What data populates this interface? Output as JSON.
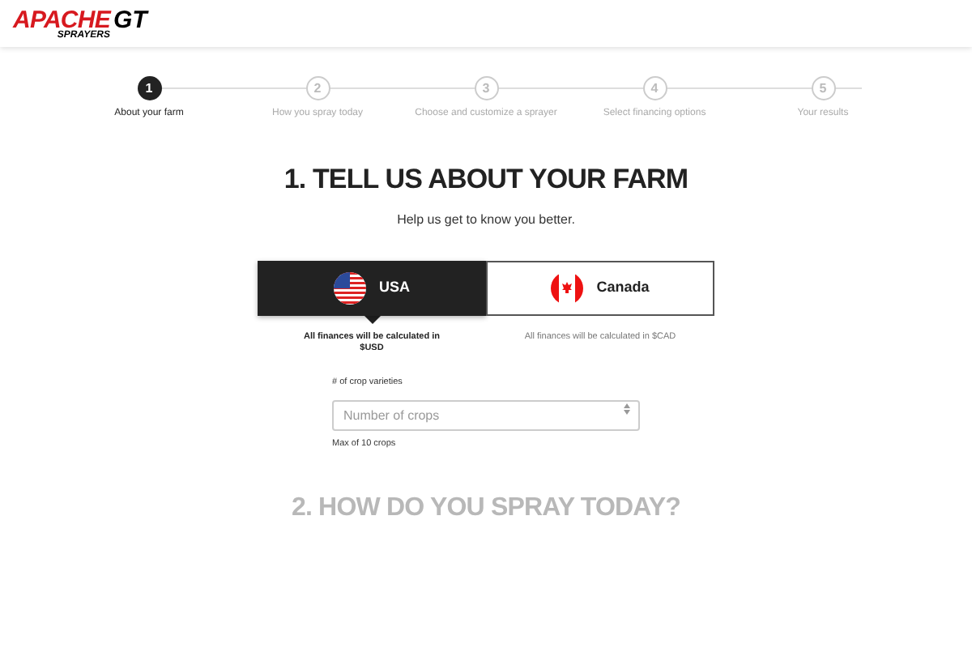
{
  "logo": {
    "name": "APACHE",
    "sub": "SPRAYERS",
    "mark": "GT"
  },
  "steps": [
    {
      "number": "1",
      "label": "About your farm",
      "selected": true
    },
    {
      "number": "2",
      "label": "How you spray today",
      "selected": false
    },
    {
      "number": "3",
      "label": "Choose and customize a sprayer",
      "selected": false
    },
    {
      "number": "4",
      "label": "Select financing options",
      "selected": false
    },
    {
      "number": "5",
      "label": "Your results",
      "selected": false
    }
  ],
  "heading": "1. TELL US ABOUT YOUR FARM",
  "subtitle": "Help us get to know you better.",
  "countries": [
    {
      "kind": "usa",
      "label": "USA",
      "note": "All finances will be calculated in $USD",
      "selected": true
    },
    {
      "kind": "canada",
      "label": "Canada",
      "note": "All finances will be calculated in $CAD",
      "selected": false
    }
  ],
  "crop_field": {
    "label": "# of crop varieties",
    "placeholder": "Number of crops",
    "hint": "Max of 10 crops"
  },
  "next_heading": "2. HOW DO YOU SPRAY TODAY?"
}
